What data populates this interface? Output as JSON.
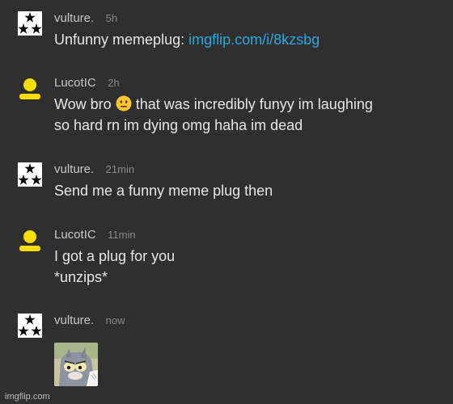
{
  "messages": [
    {
      "author": "vulture.",
      "time": "5h",
      "text": "Unfunny memeplug: ",
      "link": "imgflip.com/i/8kzsbg",
      "avatar": "three-stars-icon"
    },
    {
      "author": "LucotIC",
      "time": "2h",
      "text_before_emoji": "Wow bro ",
      "text_after_emoji": " that was incredibly funyy im laughing",
      "text_line2": "so hard rn im dying omg haha im dead",
      "emoji": "neutral-face-emoji",
      "avatar": "yellow-person-icon"
    },
    {
      "author": "vulture.",
      "time": "21min",
      "text": "Send me a funny meme plug then",
      "avatar": "three-stars-icon"
    },
    {
      "author": "LucotIC",
      "time": "11min",
      "text": "I got a plug for you",
      "text_line2": "*unzips*",
      "avatar": "yellow-person-icon"
    },
    {
      "author": "vulture.",
      "time": "now",
      "attachment": "scared-tom-cat-meme-image",
      "avatar": "three-stars-icon"
    }
  ],
  "watermark": "imgflip.com",
  "colors": {
    "background": "#2f2f2f",
    "link": "#25a8e0",
    "avatar_yellow": "#f6df00",
    "text": "#e6e6e6"
  }
}
